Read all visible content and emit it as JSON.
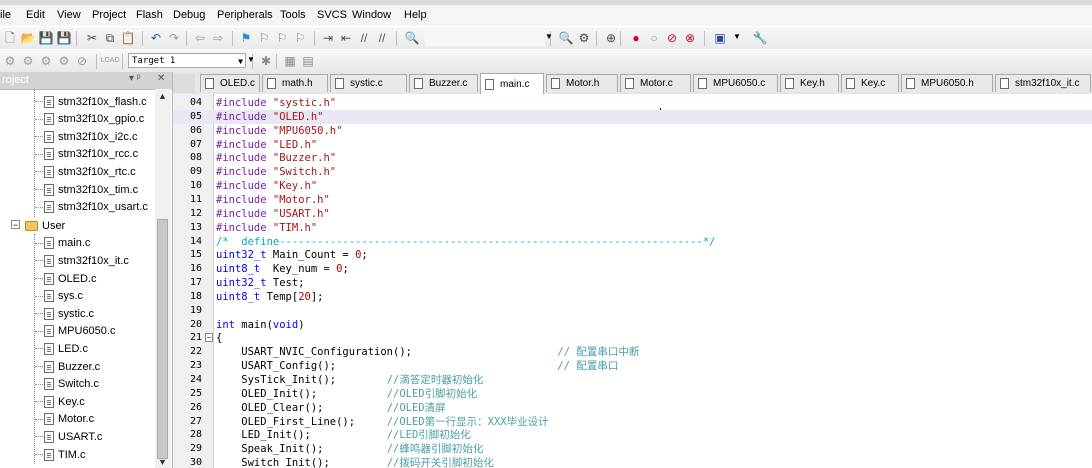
{
  "menu": [
    "ile",
    "Edit",
    "View",
    "Project",
    "Flash",
    "Debug",
    "Peripherals",
    "Tools",
    "SVCS",
    "Window",
    "Help"
  ],
  "toolbar": {
    "target": "Target 1"
  },
  "project_panel": {
    "title": "roject",
    "pin": "▾ ᵖ",
    "close": "✕"
  },
  "tree": {
    "lib_files": [
      "stm32f10x_flash.c",
      "stm32f10x_gpio.c",
      "stm32f10x_i2c.c",
      "stm32f10x_rcc.c",
      "stm32f10x_rtc.c",
      "stm32f10x_tim.c",
      "stm32f10x_usart.c"
    ],
    "group": "User",
    "user_files": [
      "main.c",
      "stm32f10x_it.c",
      "OLED.c",
      "sys.c",
      "systic.c",
      "MPU6050.c",
      "LED.c",
      "Buzzer.c",
      "Switch.c",
      "Key.c",
      "Motor.c",
      "USART.c",
      "TIM.c"
    ]
  },
  "tabs": [
    "OLED.c",
    "math.h",
    "systic.c",
    "Buzzer.c",
    "main.c",
    "Motor.h",
    "Motor.c",
    "MPU6050.c",
    "Key.h",
    "Key.c",
    "MPU6050.h",
    "stm32f10x_it.c"
  ],
  "active_tab": "main.c",
  "code_lines": [
    {
      "n": "04",
      "t": "#include \"systic.h\""
    },
    {
      "n": "05",
      "t": "#include \"OLED.h\""
    },
    {
      "n": "06",
      "t": "#include \"MPU6050.h\""
    },
    {
      "n": "07",
      "t": "#include \"LED.h\""
    },
    {
      "n": "08",
      "t": "#include \"Buzzer.h\""
    },
    {
      "n": "09",
      "t": "#include \"Switch.h\""
    },
    {
      "n": "10",
      "t": "#include \"Key.h\""
    },
    {
      "n": "11",
      "t": "#include \"Motor.h\""
    },
    {
      "n": "12",
      "t": "#include \"USART.h\""
    },
    {
      "n": "13",
      "t": "#include \"TIM.h\""
    },
    {
      "n": "14",
      "t": "/*  define-------------------------------------------------------------------*/"
    },
    {
      "n": "15",
      "t": "uint32_t Main_Count = 0;"
    },
    {
      "n": "16",
      "t": "uint8_t  Key_num = 0;"
    },
    {
      "n": "17",
      "t": "uint32_t Test;"
    },
    {
      "n": "18",
      "t": "uint8_t Temp[20];"
    },
    {
      "n": "19",
      "t": ""
    },
    {
      "n": "20",
      "t": "int main(void)"
    },
    {
      "n": "21",
      "t": "{"
    },
    {
      "n": "22",
      "t": "    USART_NVIC_Configuration();                       // 配置串口中断"
    },
    {
      "n": "23",
      "t": "    USART_Config();                                   // 配置串口"
    },
    {
      "n": "24",
      "t": "    SysTick_Init();        //滴答定时器初始化"
    },
    {
      "n": "25",
      "t": "    OLED_Init();           //OLED引脚初始化"
    },
    {
      "n": "26",
      "t": "    OLED_Clear();          //OLED清屏"
    },
    {
      "n": "27",
      "t": "    OLED_First_Line();     //OLED第一行显示：XXX毕业设计"
    },
    {
      "n": "28",
      "t": "    LED_Init();            //LED引脚初始化"
    },
    {
      "n": "29",
      "t": "    Speak_Init();          //蜂鸣器引脚初始化"
    },
    {
      "n": "30",
      "t": "    Switch_Init();         //拨码开关引脚初始化"
    }
  ]
}
